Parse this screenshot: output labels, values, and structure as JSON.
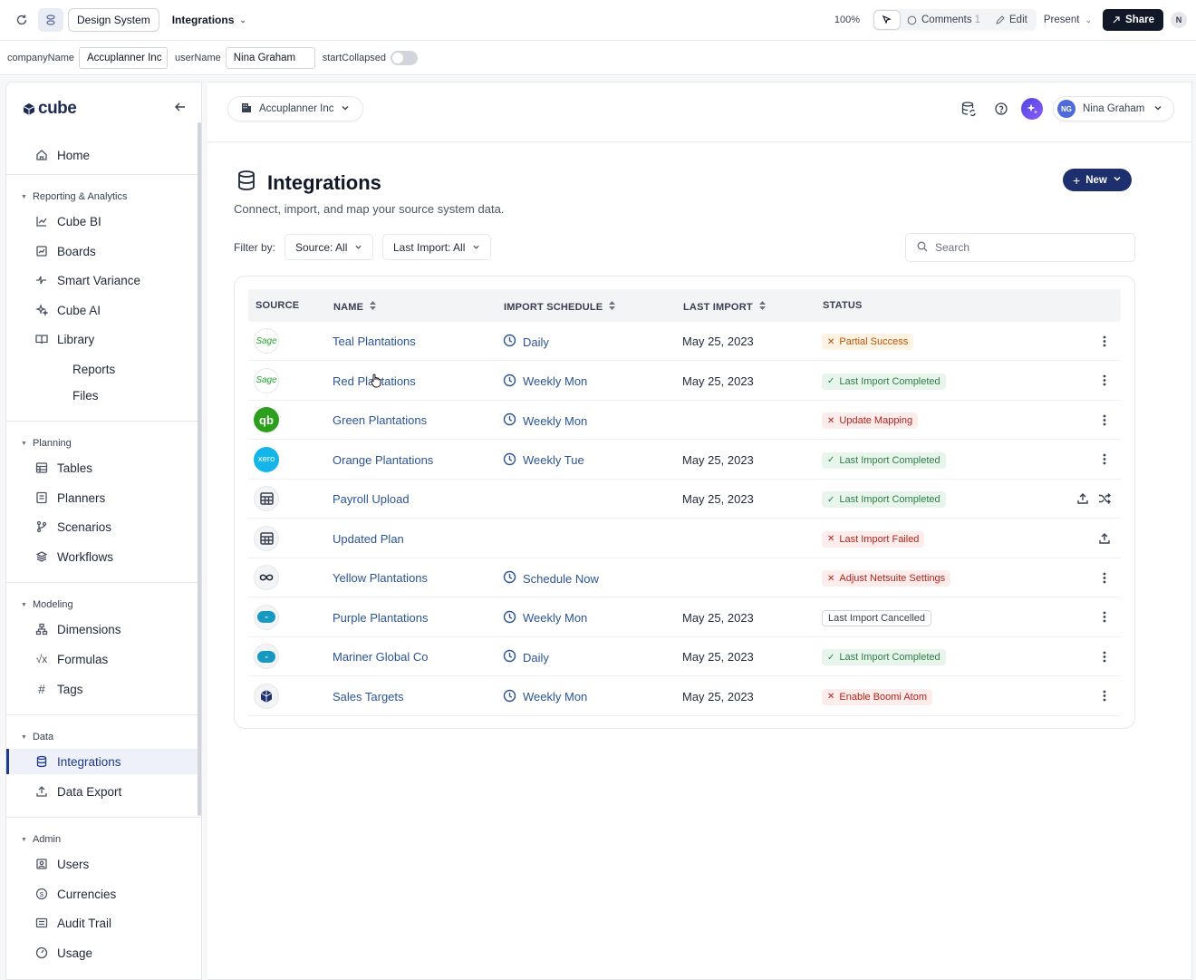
{
  "topbar": {
    "tabs": [
      {
        "label": "Design System"
      },
      {
        "label": "Integrations"
      }
    ],
    "zoom": "100%",
    "comments_label": "Comments",
    "comments_count": "1",
    "edit_label": "Edit",
    "present_label": "Present",
    "share_label": "Share",
    "avatar_initial": "N"
  },
  "props": {
    "company_label": "companyName",
    "company_value": "Accuplanner Inc",
    "user_label": "userName",
    "user_value": "Nina Graham",
    "collapsed_label": "startCollapsed",
    "collapsed_value": false
  },
  "sidebar": {
    "logo": "cube",
    "items": {
      "home": "Home",
      "cube_bi": "Cube BI",
      "boards": "Boards",
      "smart_variance": "Smart Variance",
      "cube_ai": "Cube AI",
      "library": "Library",
      "reports": "Reports",
      "files": "Files",
      "tables": "Tables",
      "planners": "Planners",
      "scenarios": "Scenarios",
      "workflows": "Workflows",
      "dimensions": "Dimensions",
      "formulas": "Formulas",
      "tags": "Tags",
      "integrations": "Integrations",
      "data_export": "Data Export",
      "users": "Users",
      "currencies": "Currencies",
      "audit_trail": "Audit Trail",
      "usage": "Usage"
    },
    "sections": {
      "reporting": "Reporting & Analytics",
      "planning": "Planning",
      "modeling": "Modeling",
      "data": "Data",
      "admin": "Admin"
    }
  },
  "header": {
    "company": "Accuplanner Inc",
    "user_initials": "NG",
    "user_name": "Nina Graham"
  },
  "page": {
    "title": "Integrations",
    "subtitle": "Connect, import, and map your source system data.",
    "new_label": "New",
    "filter_label": "Filter by:",
    "filter_source": "Source: All",
    "filter_last_import": "Last Import: All",
    "search_placeholder": "Search"
  },
  "table": {
    "columns": [
      "SOURCE",
      "NAME",
      "IMPORT SCHEDULE",
      "LAST IMPORT",
      "STATUS"
    ],
    "rows": [
      {
        "source": "Sage",
        "name": "Teal Plantations",
        "schedule": "Daily",
        "last_import": "May 25, 2023",
        "status": "Partial Success",
        "status_type": "warn",
        "actions": "menu"
      },
      {
        "source": "Sage",
        "name": "Red Plantations",
        "schedule": "Weekly Mon",
        "last_import": "May 25, 2023",
        "status": "Last Import Completed",
        "status_type": "success",
        "actions": "menu"
      },
      {
        "source": "qb",
        "name": "Green Plantations",
        "schedule": "Weekly Mon",
        "last_import": "",
        "status": "Update Mapping",
        "status_type": "error",
        "actions": "menu"
      },
      {
        "source": "xero",
        "name": "Orange Plantations",
        "schedule": "Weekly Tue",
        "last_import": "May 25, 2023",
        "status": "Last Import Completed",
        "status_type": "success",
        "actions": "menu"
      },
      {
        "source": "table",
        "name": "Payroll Upload",
        "schedule": "",
        "last_import": "May 25, 2023",
        "status": "Last Import Completed",
        "status_type": "success",
        "actions": "upload-shuffle"
      },
      {
        "source": "table",
        "name": "Updated Plan",
        "schedule": "",
        "last_import": "",
        "status": "Last Import Failed",
        "status_type": "error",
        "actions": "upload"
      },
      {
        "source": "netsuite",
        "name": "Yellow Plantations",
        "schedule": "Schedule Now",
        "last_import": "",
        "status": "Adjust Netsuite Settings",
        "status_type": "error",
        "actions": "menu"
      },
      {
        "source": "salesforce",
        "name": "Purple Plantations",
        "schedule": "Weekly Mon",
        "last_import": "May 25, 2023",
        "status": "Last Import Cancelled",
        "status_type": "neutral",
        "actions": "menu"
      },
      {
        "source": "salesforce",
        "name": "Mariner Global Co",
        "schedule": "Daily",
        "last_import": "May 25, 2023",
        "status": "Last Import Completed",
        "status_type": "success",
        "actions": "menu"
      },
      {
        "source": "boomi",
        "name": "Sales Targets",
        "schedule": "Weekly Mon",
        "last_import": "May 25, 2023",
        "status": "Enable Boomi Atom",
        "status_type": "error",
        "actions": "menu"
      }
    ]
  },
  "colors": {
    "accent": "#1e2f6e",
    "link": "#2b5494",
    "success": "#2f7d45",
    "error": "#b42318",
    "warning": "#b45309"
  }
}
